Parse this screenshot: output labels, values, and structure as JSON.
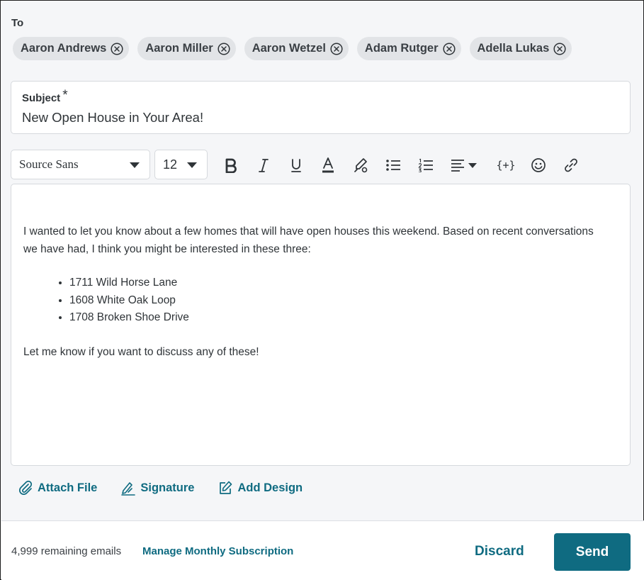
{
  "to": {
    "label": "To",
    "recipients": [
      "Aaron Andrews",
      "Aaron Miller",
      "Aaron Wetzel",
      "Adam Rutger",
      "Adella Lukas"
    ]
  },
  "subject": {
    "label": "Subject",
    "required_mark": "*",
    "value": "New Open House in Your Area!"
  },
  "toolbar": {
    "font_family": "Source Sans",
    "font_size": "12",
    "icons": [
      "bold-icon",
      "italic-icon",
      "underline-icon",
      "text-color-icon",
      "highlight-icon",
      "bulleted-list-icon",
      "numbered-list-icon",
      "align-icon",
      "merge-field-icon",
      "emoji-icon",
      "link-icon"
    ],
    "merge_field_glyph": "{+}"
  },
  "body": {
    "paragraph1": "I wanted to let you know about a few homes that will have open houses this weekend. Based on recent conversations we have had, I think you might be interested in these three:",
    "list": [
      "1711 Wild Horse Lane",
      "1608 White Oak Loop",
      "1708 Broken Shoe Drive"
    ],
    "paragraph2": "Let me know if you want to discuss any of these!"
  },
  "attachments": {
    "attach_file": "Attach File",
    "signature": "Signature",
    "add_design": "Add Design"
  },
  "footer": {
    "remaining": "4,999 remaining emails",
    "manage": "Manage Monthly Subscription",
    "discard": "Discard",
    "send": "Send"
  },
  "colors": {
    "accent": "#0f6b81",
    "chip_bg": "#e2e4e7",
    "panel_bg": "#f5f6f8"
  }
}
